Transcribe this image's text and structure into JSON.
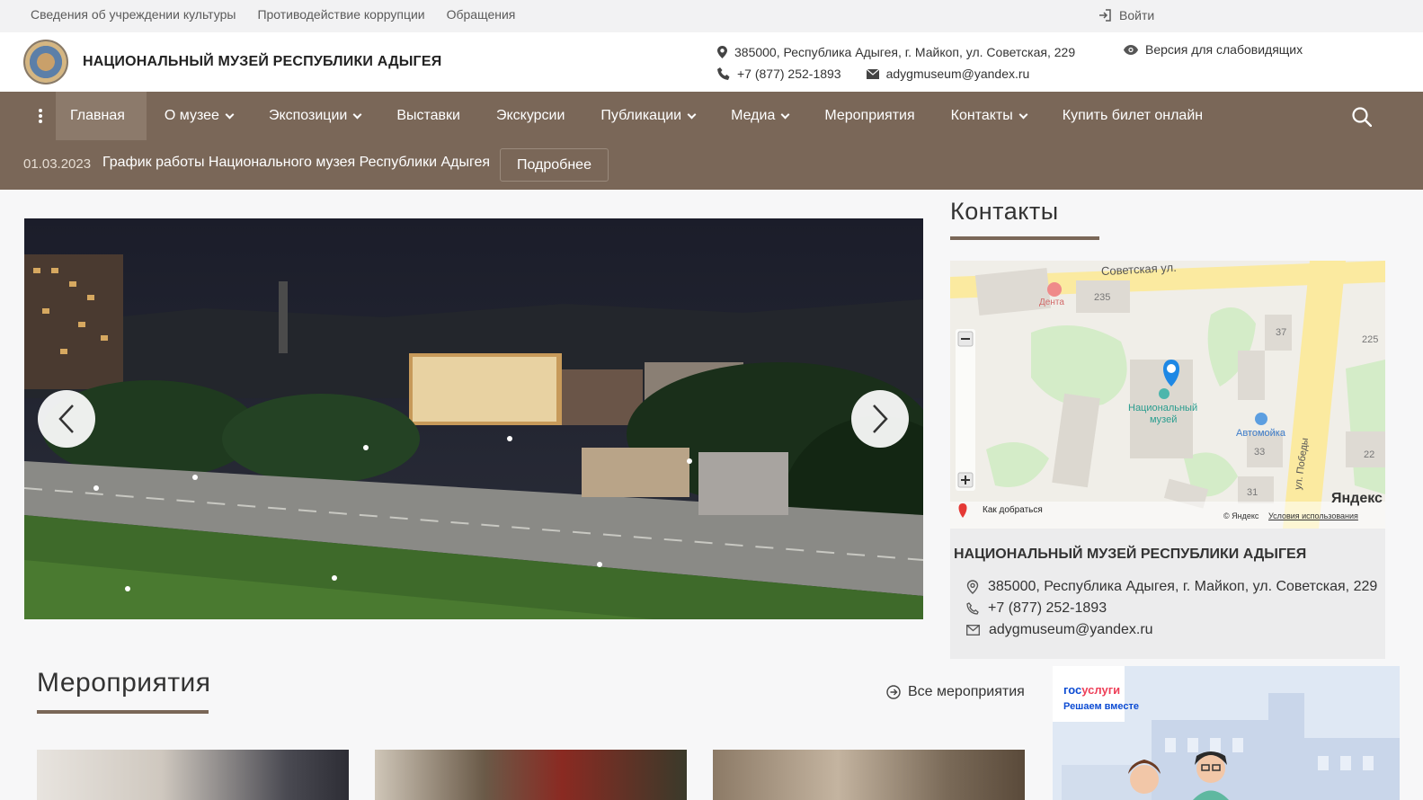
{
  "topbar": {
    "links": [
      "Сведения об учреждении культуры",
      "Противодействие коррупции",
      "Обращения"
    ],
    "login": "Войти"
  },
  "header": {
    "title": "НАЦИОНАЛЬНЫЙ МУЗЕЙ РЕСПУБЛИКИ АДЫГЕЯ",
    "address": "385000, Республика Адыгея, г. Майкоп, ул. Советская, 229",
    "phone": "+7 (877) 252-1893",
    "email": "adygmuseum@yandex.ru",
    "vision_version": "Версия для слабовидящих"
  },
  "nav": {
    "items": [
      {
        "label": "Главная",
        "dropdown": false,
        "active": true
      },
      {
        "label": "О музее",
        "dropdown": true
      },
      {
        "label": "Экспозиции",
        "dropdown": true
      },
      {
        "label": "Выставки",
        "dropdown": false
      },
      {
        "label": "Экскурсии",
        "dropdown": false
      },
      {
        "label": "Публикации",
        "dropdown": true
      },
      {
        "label": "Медиа",
        "dropdown": true
      },
      {
        "label": "Мероприятия",
        "dropdown": false
      },
      {
        "label": "Контакты",
        "dropdown": true
      },
      {
        "label": "Купить билет онлайн",
        "dropdown": false
      }
    ]
  },
  "news": {
    "date": "01.03.2023",
    "text": "График работы Национального музея Республики Адыгея",
    "button": "Подробнее"
  },
  "contacts": {
    "title": "Контакты",
    "map": {
      "street_top": "Советская ул.",
      "poi_denta": "Дента",
      "house_235": "235",
      "house_37": "37",
      "house_225": "225",
      "museum_label_1": "Национальный",
      "museum_label_2": "музей",
      "car_wash": "Автомойка",
      "house_33": "33",
      "house_22": "22",
      "house_31": "31",
      "street_pobedy": "ул. Победы",
      "directions": "Как добраться",
      "copyright": "© Яндекс",
      "terms": "Условия использования",
      "brand": "Яндекс"
    },
    "card": {
      "name": "НАЦИОНАЛЬНЫЙ МУЗЕЙ РЕСПУБЛИКИ АДЫГЕЯ",
      "address": "385000, Республика Адыгея, г. Майкоп, ул. Советская, 229",
      "phone": "+7 (877) 252-1893",
      "email": "adygmuseum@yandex.ru"
    }
  },
  "events": {
    "title": "Мероприятия",
    "all_link": "Все мероприятия"
  },
  "gosuslugi": {
    "brand_a": "гос",
    "brand_b": "услуги",
    "slogan": "Решаем вместе"
  },
  "colors": {
    "nav_bg": "#7a6758",
    "accent": "#7a6758",
    "gosu_blue": "#0d4cd3",
    "gosu_red": "#ee3f58"
  }
}
